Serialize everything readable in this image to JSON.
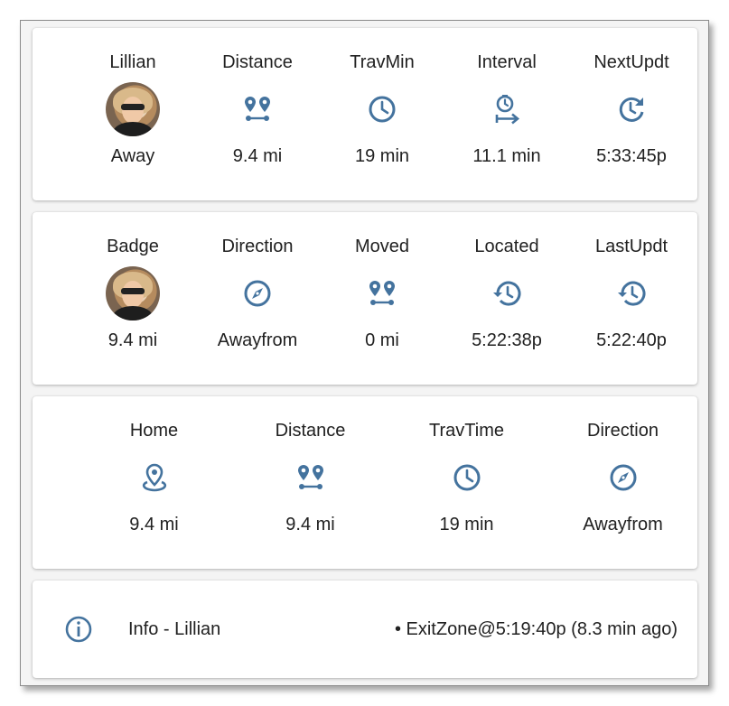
{
  "accent_color": "#44739e",
  "row1": [
    {
      "label": "Lillian",
      "icon": "avatar",
      "value": "Away"
    },
    {
      "label": "Distance",
      "icon": "map-marker-distance-icon",
      "value": "9.4 mi"
    },
    {
      "label": "TravMin",
      "icon": "clock-outline-icon",
      "value": "19 min"
    },
    {
      "label": "Interval",
      "icon": "timer-arrow-right-icon",
      "value": "11.1 min"
    },
    {
      "label": "NextUpdt",
      "icon": "update-icon",
      "value": "5:33:45p"
    }
  ],
  "row2": [
    {
      "label": "Badge",
      "icon": "avatar",
      "value": "9.4 mi"
    },
    {
      "label": "Direction",
      "icon": "compass-outline-icon",
      "value": "Awayfrom"
    },
    {
      "label": "Moved",
      "icon": "map-marker-distance-icon",
      "value": "0 mi"
    },
    {
      "label": "Located",
      "icon": "history-icon",
      "value": "5:22:38p"
    },
    {
      "label": "LastUpdt",
      "icon": "history-icon",
      "value": "5:22:40p"
    }
  ],
  "row3": [
    {
      "label": "Home",
      "icon": "map-marker-radius-icon",
      "value": "9.4 mi"
    },
    {
      "label": "Distance",
      "icon": "map-marker-distance-icon",
      "value": "9.4 mi"
    },
    {
      "label": "TravTime",
      "icon": "clock-outline-icon",
      "value": "19 min"
    },
    {
      "label": "Direction",
      "icon": "compass-outline-icon",
      "value": "Awayfrom"
    }
  ],
  "info": {
    "icon": "information-outline-icon",
    "title": "Info - Lillian",
    "status": "• ExitZone@5:19:40p (8.3 min ago)"
  }
}
